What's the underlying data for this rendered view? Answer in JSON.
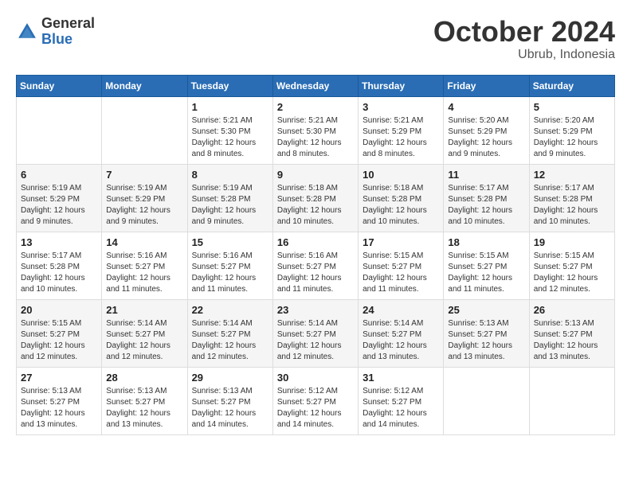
{
  "logo": {
    "general": "General",
    "blue": "Blue"
  },
  "header": {
    "month": "October 2024",
    "location": "Ubrub, Indonesia"
  },
  "weekdays": [
    "Sunday",
    "Monday",
    "Tuesday",
    "Wednesday",
    "Thursday",
    "Friday",
    "Saturday"
  ],
  "weeks": [
    [
      {
        "day": "",
        "sunrise": "",
        "sunset": "",
        "daylight": ""
      },
      {
        "day": "",
        "sunrise": "",
        "sunset": "",
        "daylight": ""
      },
      {
        "day": "1",
        "sunrise": "Sunrise: 5:21 AM",
        "sunset": "Sunset: 5:30 PM",
        "daylight": "Daylight: 12 hours and 8 minutes."
      },
      {
        "day": "2",
        "sunrise": "Sunrise: 5:21 AM",
        "sunset": "Sunset: 5:30 PM",
        "daylight": "Daylight: 12 hours and 8 minutes."
      },
      {
        "day": "3",
        "sunrise": "Sunrise: 5:21 AM",
        "sunset": "Sunset: 5:29 PM",
        "daylight": "Daylight: 12 hours and 8 minutes."
      },
      {
        "day": "4",
        "sunrise": "Sunrise: 5:20 AM",
        "sunset": "Sunset: 5:29 PM",
        "daylight": "Daylight: 12 hours and 9 minutes."
      },
      {
        "day": "5",
        "sunrise": "Sunrise: 5:20 AM",
        "sunset": "Sunset: 5:29 PM",
        "daylight": "Daylight: 12 hours and 9 minutes."
      }
    ],
    [
      {
        "day": "6",
        "sunrise": "Sunrise: 5:19 AM",
        "sunset": "Sunset: 5:29 PM",
        "daylight": "Daylight: 12 hours and 9 minutes."
      },
      {
        "day": "7",
        "sunrise": "Sunrise: 5:19 AM",
        "sunset": "Sunset: 5:29 PM",
        "daylight": "Daylight: 12 hours and 9 minutes."
      },
      {
        "day": "8",
        "sunrise": "Sunrise: 5:19 AM",
        "sunset": "Sunset: 5:28 PM",
        "daylight": "Daylight: 12 hours and 9 minutes."
      },
      {
        "day": "9",
        "sunrise": "Sunrise: 5:18 AM",
        "sunset": "Sunset: 5:28 PM",
        "daylight": "Daylight: 12 hours and 10 minutes."
      },
      {
        "day": "10",
        "sunrise": "Sunrise: 5:18 AM",
        "sunset": "Sunset: 5:28 PM",
        "daylight": "Daylight: 12 hours and 10 minutes."
      },
      {
        "day": "11",
        "sunrise": "Sunrise: 5:17 AM",
        "sunset": "Sunset: 5:28 PM",
        "daylight": "Daylight: 12 hours and 10 minutes."
      },
      {
        "day": "12",
        "sunrise": "Sunrise: 5:17 AM",
        "sunset": "Sunset: 5:28 PM",
        "daylight": "Daylight: 12 hours and 10 minutes."
      }
    ],
    [
      {
        "day": "13",
        "sunrise": "Sunrise: 5:17 AM",
        "sunset": "Sunset: 5:28 PM",
        "daylight": "Daylight: 12 hours and 10 minutes."
      },
      {
        "day": "14",
        "sunrise": "Sunrise: 5:16 AM",
        "sunset": "Sunset: 5:27 PM",
        "daylight": "Daylight: 12 hours and 11 minutes."
      },
      {
        "day": "15",
        "sunrise": "Sunrise: 5:16 AM",
        "sunset": "Sunset: 5:27 PM",
        "daylight": "Daylight: 12 hours and 11 minutes."
      },
      {
        "day": "16",
        "sunrise": "Sunrise: 5:16 AM",
        "sunset": "Sunset: 5:27 PM",
        "daylight": "Daylight: 12 hours and 11 minutes."
      },
      {
        "day": "17",
        "sunrise": "Sunrise: 5:15 AM",
        "sunset": "Sunset: 5:27 PM",
        "daylight": "Daylight: 12 hours and 11 minutes."
      },
      {
        "day": "18",
        "sunrise": "Sunrise: 5:15 AM",
        "sunset": "Sunset: 5:27 PM",
        "daylight": "Daylight: 12 hours and 11 minutes."
      },
      {
        "day": "19",
        "sunrise": "Sunrise: 5:15 AM",
        "sunset": "Sunset: 5:27 PM",
        "daylight": "Daylight: 12 hours and 12 minutes."
      }
    ],
    [
      {
        "day": "20",
        "sunrise": "Sunrise: 5:15 AM",
        "sunset": "Sunset: 5:27 PM",
        "daylight": "Daylight: 12 hours and 12 minutes."
      },
      {
        "day": "21",
        "sunrise": "Sunrise: 5:14 AM",
        "sunset": "Sunset: 5:27 PM",
        "daylight": "Daylight: 12 hours and 12 minutes."
      },
      {
        "day": "22",
        "sunrise": "Sunrise: 5:14 AM",
        "sunset": "Sunset: 5:27 PM",
        "daylight": "Daylight: 12 hours and 12 minutes."
      },
      {
        "day": "23",
        "sunrise": "Sunrise: 5:14 AM",
        "sunset": "Sunset: 5:27 PM",
        "daylight": "Daylight: 12 hours and 12 minutes."
      },
      {
        "day": "24",
        "sunrise": "Sunrise: 5:14 AM",
        "sunset": "Sunset: 5:27 PM",
        "daylight": "Daylight: 12 hours and 13 minutes."
      },
      {
        "day": "25",
        "sunrise": "Sunrise: 5:13 AM",
        "sunset": "Sunset: 5:27 PM",
        "daylight": "Daylight: 12 hours and 13 minutes."
      },
      {
        "day": "26",
        "sunrise": "Sunrise: 5:13 AM",
        "sunset": "Sunset: 5:27 PM",
        "daylight": "Daylight: 12 hours and 13 minutes."
      }
    ],
    [
      {
        "day": "27",
        "sunrise": "Sunrise: 5:13 AM",
        "sunset": "Sunset: 5:27 PM",
        "daylight": "Daylight: 12 hours and 13 minutes."
      },
      {
        "day": "28",
        "sunrise": "Sunrise: 5:13 AM",
        "sunset": "Sunset: 5:27 PM",
        "daylight": "Daylight: 12 hours and 13 minutes."
      },
      {
        "day": "29",
        "sunrise": "Sunrise: 5:13 AM",
        "sunset": "Sunset: 5:27 PM",
        "daylight": "Daylight: 12 hours and 14 minutes."
      },
      {
        "day": "30",
        "sunrise": "Sunrise: 5:12 AM",
        "sunset": "Sunset: 5:27 PM",
        "daylight": "Daylight: 12 hours and 14 minutes."
      },
      {
        "day": "31",
        "sunrise": "Sunrise: 5:12 AM",
        "sunset": "Sunset: 5:27 PM",
        "daylight": "Daylight: 12 hours and 14 minutes."
      },
      {
        "day": "",
        "sunrise": "",
        "sunset": "",
        "daylight": ""
      },
      {
        "day": "",
        "sunrise": "",
        "sunset": "",
        "daylight": ""
      }
    ]
  ]
}
